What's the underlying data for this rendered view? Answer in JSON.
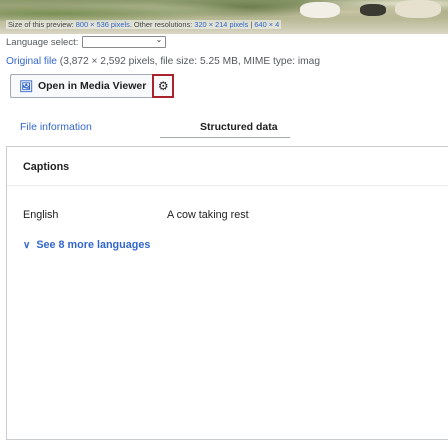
{
  "preview": {
    "caption_prefix": "Size of this preview: ",
    "caption_size": "800 × 536 pixels",
    "caption_other": ". Other resolutions: ",
    "caption_res1": "320 × 214 pixels",
    "caption_sep": " | ",
    "caption_res2": "640 × 4"
  },
  "language": {
    "label": "Language select:",
    "value": ""
  },
  "original_file": {
    "link_text": "Original file",
    "details": " (3,872 × 2,592 pixels, file size: 5.25 MB, MIME type: imag"
  },
  "media_viewer": {
    "open_label": "Open in Media Viewer",
    "icon": "image-icon",
    "settings_icon": "gear-icon"
  },
  "tabs": {
    "file_info": "File information",
    "structured": "Structured data"
  },
  "captions": {
    "title": "Captions",
    "language": "English",
    "text": "A cow taking rest",
    "see_more": "See 8 more languages"
  },
  "colors": {
    "link": "#3366cc",
    "highlight_frame": "#a9232a",
    "border": "#a2a9b1"
  }
}
